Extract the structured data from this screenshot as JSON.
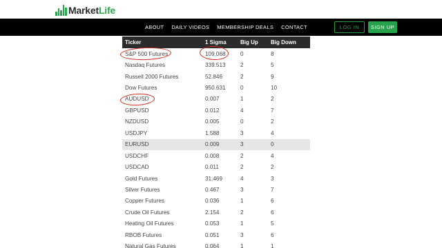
{
  "header": {
    "logo_prefix": "Market",
    "logo_accent": "Life",
    "brand_color": "#2aa64f"
  },
  "nav": {
    "links": [
      "ABOUT",
      "DAILY VIDEOS",
      "MEMBERSHIP DEALS",
      "CONTACT"
    ],
    "login_label": "LOG IN",
    "signup_label": "SIGN UP"
  },
  "table": {
    "headers": [
      "Ticker",
      "1 Sigma",
      "Big Up",
      "Big Down"
    ],
    "rows": [
      [
        "S&P 500 Futures",
        "109.068",
        "0",
        "8"
      ],
      [
        "Nasdaq Futures",
        "339.513",
        "2",
        "5"
      ],
      [
        "Russell 2000 Futures",
        "52.846",
        "2",
        "9"
      ],
      [
        "Dow Futures",
        "950.631",
        "0",
        "10"
      ],
      [
        "AUDUSD",
        "0.007",
        "1",
        "2"
      ],
      [
        "GBPUSD",
        "0.012",
        "4",
        "7"
      ],
      [
        "NZDUSD",
        "0.005",
        "0",
        "2"
      ],
      [
        "USDJPY",
        "1.588",
        "3",
        "4"
      ],
      [
        "EURUSD",
        "0.009",
        "3",
        "0"
      ],
      [
        "USDCHF",
        "0.008",
        "2",
        "4"
      ],
      [
        "USDCAD",
        "0.011",
        "2",
        "2"
      ],
      [
        "Gold Futures",
        "31.469",
        "4",
        "3"
      ],
      [
        "Silver Futures",
        "0.467",
        "3",
        "7"
      ],
      [
        "Copper Futures",
        "0.036",
        "1",
        "6"
      ],
      [
        "Crude Oil Futures",
        "2.154",
        "2",
        "6"
      ],
      [
        "Heating Oil Futures",
        "0.053",
        "1",
        "5"
      ],
      [
        "RBOB Futures",
        "0.051",
        "3",
        "6"
      ],
      [
        "Natural Gas Futures",
        "0.064",
        "1",
        "1"
      ]
    ],
    "highlighted_row": "EURUSD"
  }
}
